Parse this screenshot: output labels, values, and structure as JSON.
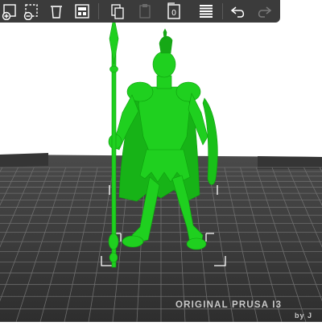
{
  "scene": {
    "bed_label": "ORIGINAL PRUSA I3",
    "bed_author": "by J",
    "model_color": "#1fd01f",
    "bed_color": "#3c3c3c",
    "background_color": "#ffffff"
  },
  "toolbar": {
    "background": "#3b3b3b",
    "items": [
      {
        "name": "add-instance-button",
        "icon": "add-icon"
      },
      {
        "name": "remove-instance-button",
        "icon": "remove-icon"
      },
      {
        "name": "delete-all-button",
        "icon": "delete-all-icon"
      },
      {
        "name": "arrange-button",
        "icon": "arrange-icon"
      },
      {
        "name": "copy-button",
        "icon": "copy-icon"
      },
      {
        "name": "paste-button",
        "icon": "paste-icon"
      },
      {
        "name": "split-to-objects-button",
        "icon": "split-icon",
        "badge": "0"
      },
      {
        "name": "layers-editing-button",
        "icon": "layers-icon"
      },
      {
        "name": "undo-button",
        "icon": "undo-icon"
      },
      {
        "name": "redo-button",
        "icon": "redo-icon"
      }
    ]
  }
}
